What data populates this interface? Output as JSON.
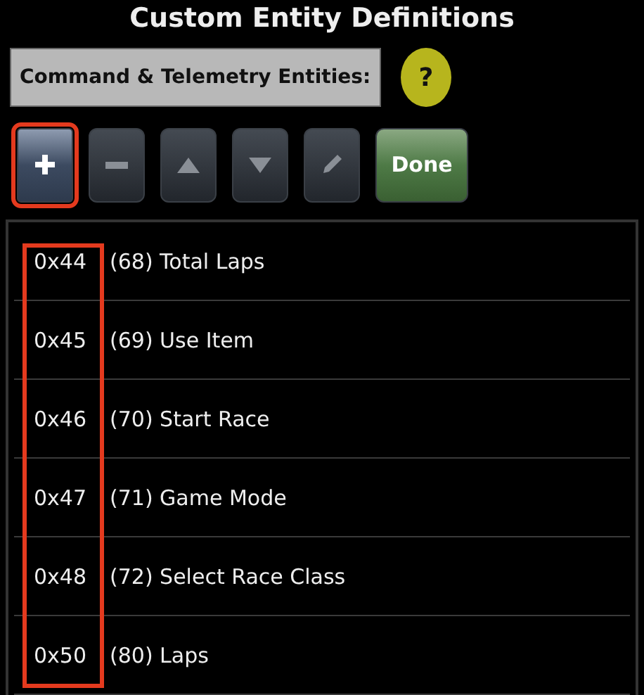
{
  "title": "Custom Entity Definitions",
  "section_label": "Command & Telemetry Entities:",
  "help_button": "?",
  "toolbar": [
    {
      "kind": "add",
      "highlighted": true
    },
    {
      "kind": "remove",
      "highlighted": false
    },
    {
      "kind": "up",
      "highlighted": false
    },
    {
      "kind": "down",
      "highlighted": false
    },
    {
      "kind": "edit",
      "highlighted": false
    },
    {
      "kind": "done",
      "label": "Done",
      "highlighted": false
    }
  ],
  "entities": {
    "hex_column_highlighted": true,
    "rows": [
      {
        "hex": "0x44",
        "name": "(68) Total Laps"
      },
      {
        "hex": "0x45",
        "name": "(69) Use Item"
      },
      {
        "hex": "0x46",
        "name": "(70) Start Race"
      },
      {
        "hex": "0x47",
        "name": "(71) Game Mode"
      },
      {
        "hex": "0x48",
        "name": "(72) Select Race Class"
      },
      {
        "hex": "0x50",
        "name": "(80) Laps"
      }
    ]
  }
}
